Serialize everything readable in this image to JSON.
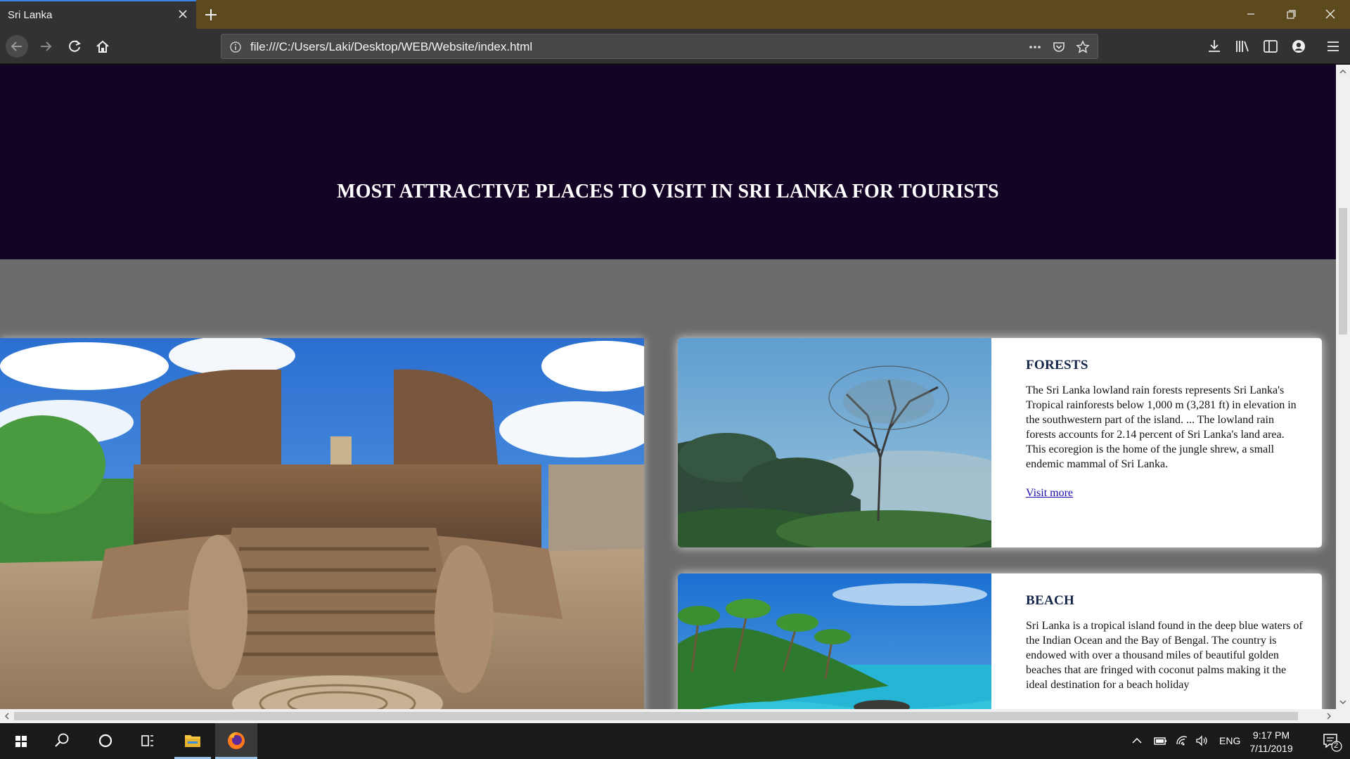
{
  "browser": {
    "tab_title": "Sri Lanka",
    "url": "file:///C:/Users/Laki/Desktop/WEB/Website/index.html"
  },
  "page": {
    "hero_title": "MOST ATTRACTIVE PLACES TO VISIT IN SRI LANKA FOR TOURISTS",
    "cards": [
      {
        "title": "FORESTS",
        "text": "The Sri Lanka lowland rain forests represents Sri Lanka's Tropical rainforests below 1,000 m (3,281 ft) in elevation in the southwestern part of the island. ... The lowland rain forests accounts for 2.14 percent of Sri Lanka's land area. This ecoregion is the home of the jungle shrew, a small endemic mammal of Sri Lanka.",
        "link": "Visit more"
      },
      {
        "title": "BEACH",
        "text": "Sri Lanka is a tropical island found in the deep blue waters of the Indian Ocean and the Bay of Bengal. The country is endowed with over a thousand miles of beautiful golden beaches that are fringed with coconut palms making it the ideal destination for a beach holiday",
        "link": ""
      }
    ]
  },
  "taskbar": {
    "language": "ENG",
    "time": "9:17 PM",
    "date": "7/11/2019",
    "notification_count": "2"
  },
  "colors": {
    "hero_bg": "#130324",
    "page_bg": "#6b6b6b",
    "title_bar": "#5c4a1e",
    "toolbar": "#323234",
    "card_title": "#14254a"
  }
}
